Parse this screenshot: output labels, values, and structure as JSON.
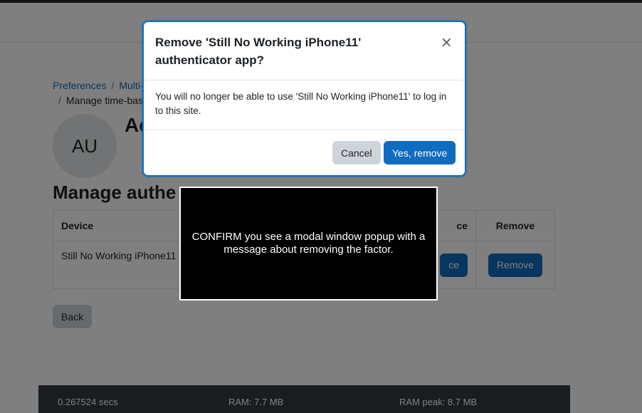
{
  "breadcrumb": {
    "items": [
      "Preferences",
      "Multi-f"
    ],
    "current": "Manage time-base"
  },
  "profile": {
    "initials": "AU",
    "heading": "Ac"
  },
  "section": {
    "title": "Manage authe"
  },
  "table": {
    "headers": {
      "device": "Device",
      "replace": "ce",
      "remove": "Remove"
    },
    "rows": [
      {
        "device": "Still No Working iPhone11",
        "replace_label": "ce",
        "remove_label": "Remove"
      }
    ]
  },
  "back_label": "Back",
  "footer": {
    "time": "0.267524 secs",
    "ram": "RAM: 7.7 MB",
    "ram_peak": "RAM peak: 8.7 MB"
  },
  "modal": {
    "title": "Remove 'Still No Working iPhone11' authenticator app?",
    "close_symbol": "×",
    "body": "You will no longer be able to use 'Still No Working iPhone11' to log in to this site.",
    "cancel_label": "Cancel",
    "confirm_label": "Yes, remove"
  },
  "test_box": {
    "message": "CONFIRM you see a modal window popup with a message about removing the factor."
  },
  "colors": {
    "primary": "#0f6cbf",
    "secondary_button": "#ced4da",
    "footer_bg": "#343a40"
  }
}
